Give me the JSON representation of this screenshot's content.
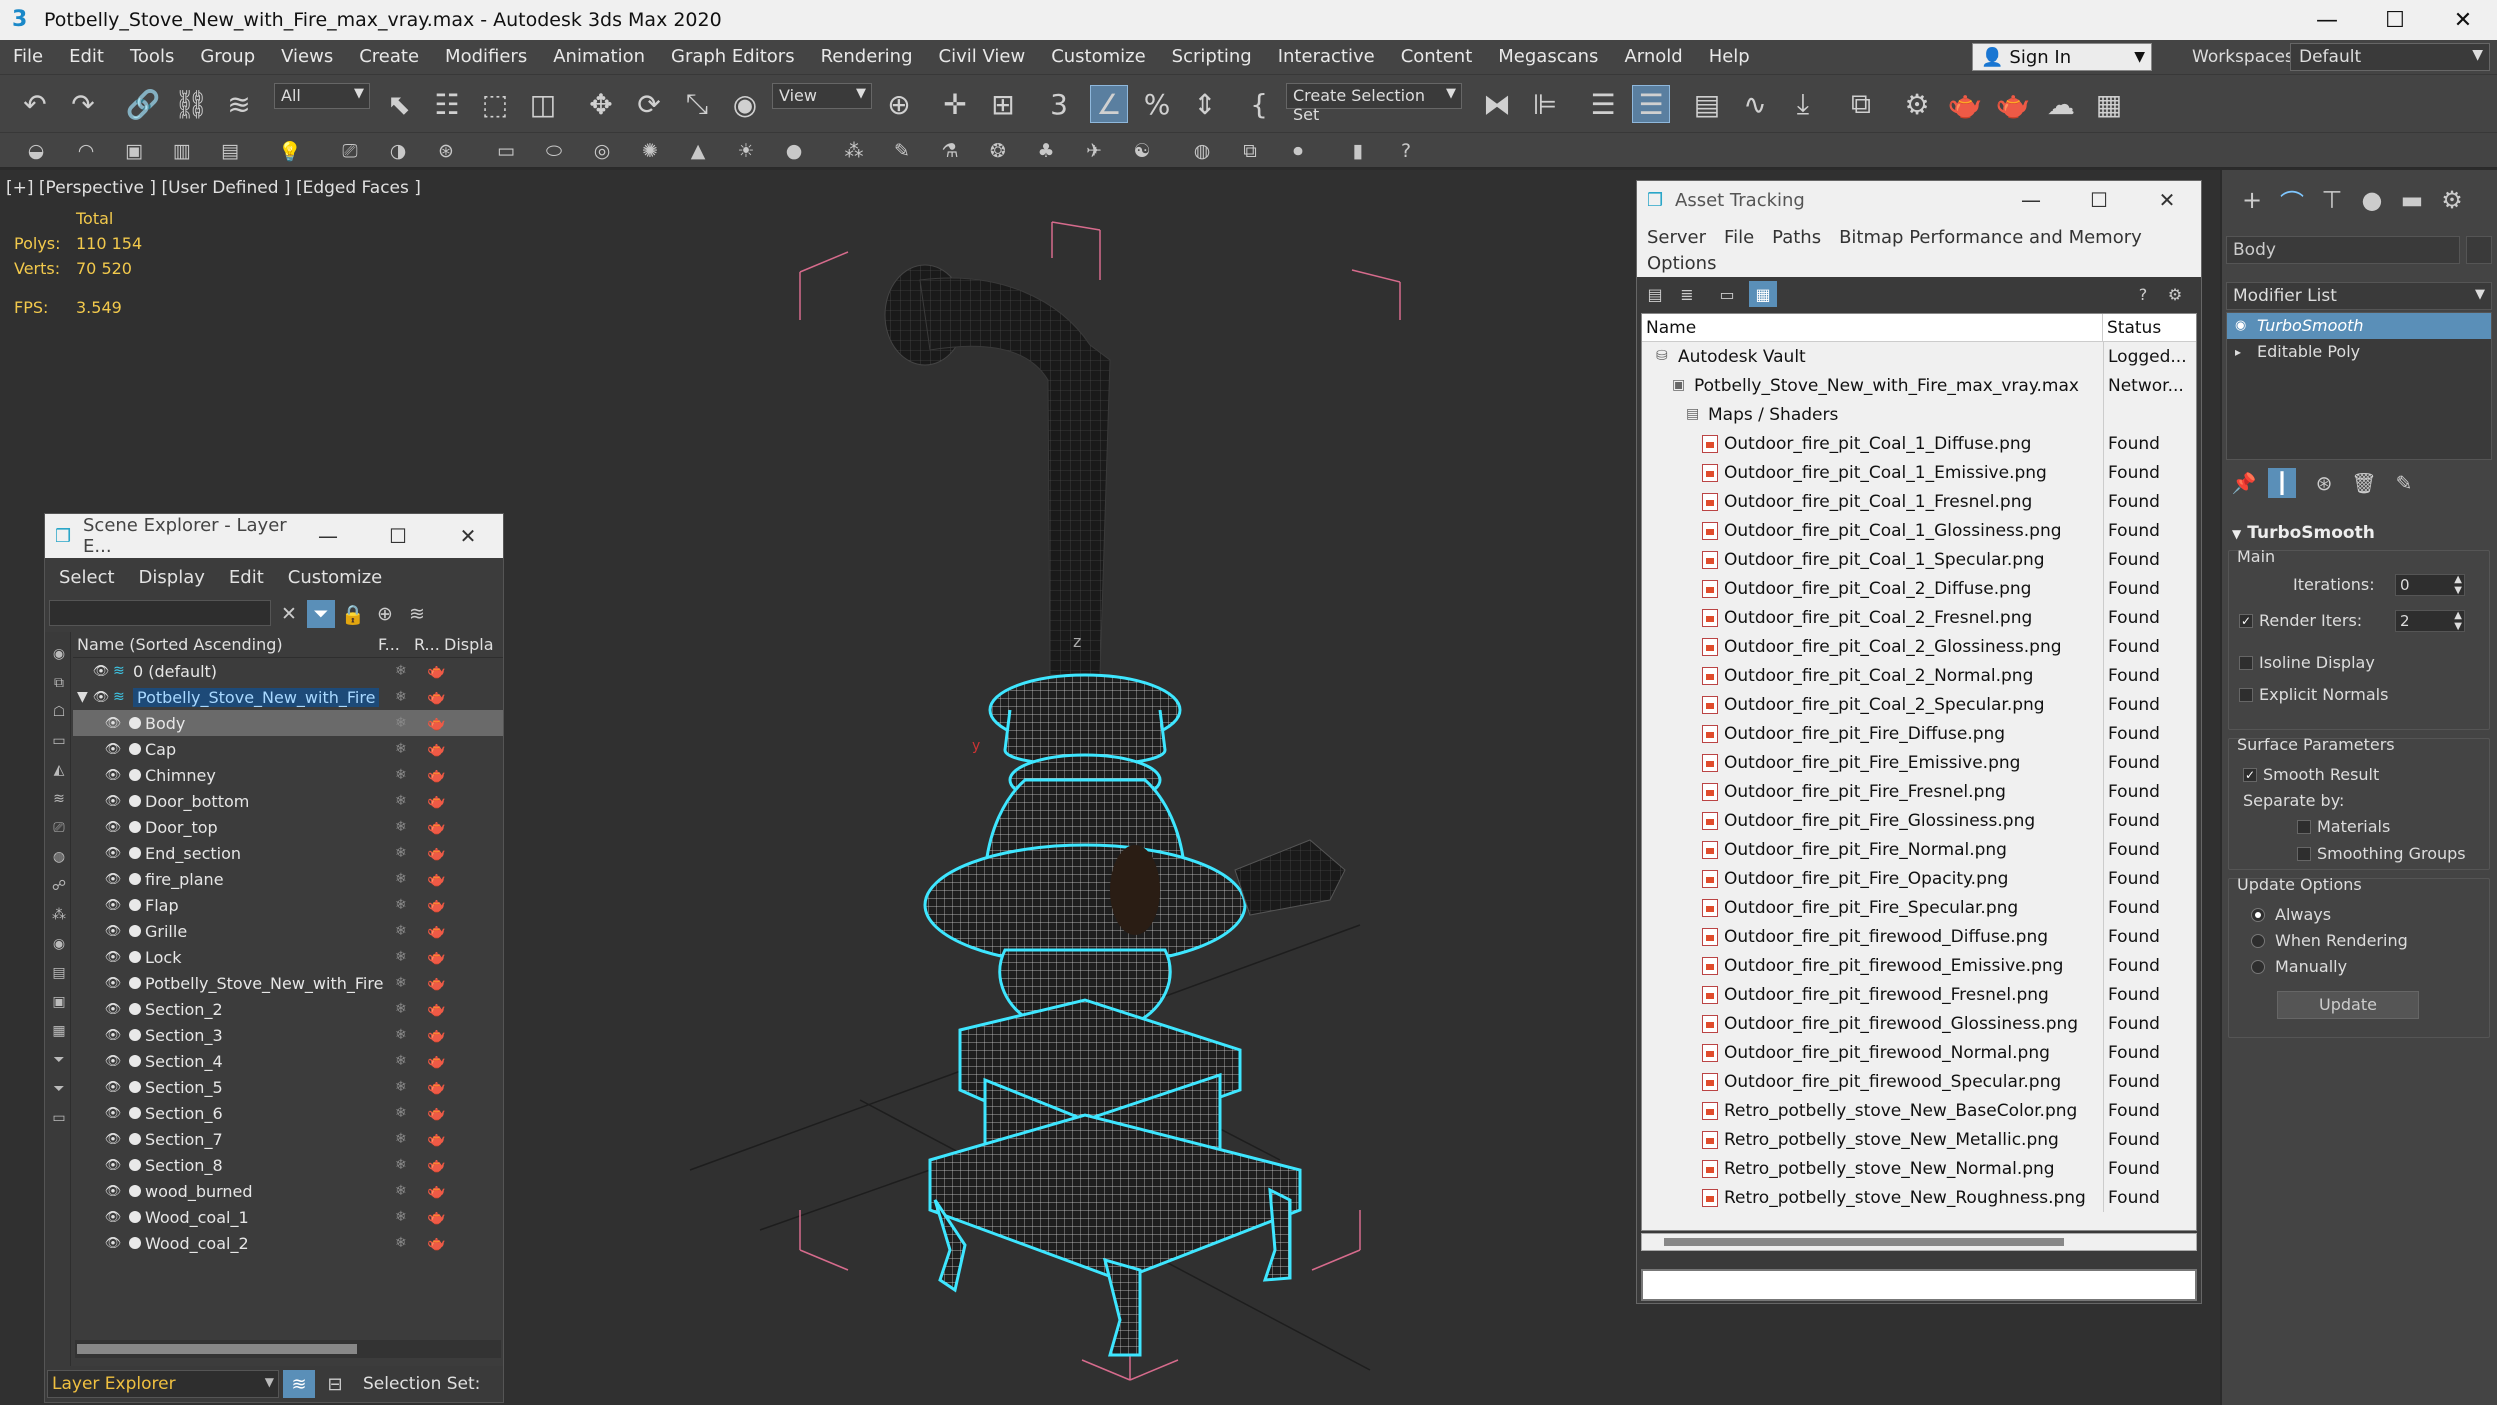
{
  "window": {
    "title": "Potbelly_Stove_New_with_Fire_max_vray.max - Autodesk 3ds Max 2020",
    "app_icon": "3",
    "minimize": "—",
    "maximize": "☐",
    "close": "✕"
  },
  "menu": [
    "File",
    "Edit",
    "Tools",
    "Group",
    "Views",
    "Create",
    "Modifiers",
    "Animation",
    "Graph Editors",
    "Rendering",
    "Civil View",
    "Customize",
    "Scripting",
    "Interactive",
    "Content",
    "Megascans",
    "Arnold",
    "Help"
  ],
  "signin": {
    "label": "Sign In"
  },
  "workspaces": {
    "label": "Workspaces:",
    "value": "Default"
  },
  "toolbar": {
    "selection_filter": "All",
    "reference_coord": "View",
    "selection_set_placeholder": "Create Selection Set"
  },
  "viewport": {
    "label": "[+] [Perspective ] [User Defined ] [Edged Faces ]",
    "stats": {
      "total_label": "Total",
      "polys_label": "Polys:",
      "polys_value": "110 154",
      "verts_label": "Verts:",
      "verts_value": "70 520",
      "fps_label": "FPS:",
      "fps_value": "3.549"
    },
    "axis_z": "z",
    "axis_y": "y"
  },
  "scene_explorer": {
    "title": "Scene Explorer - Layer E...",
    "menu": [
      "Select",
      "Display",
      "Edit",
      "Customize"
    ],
    "columns": {
      "name": "Name (Sorted Ascending)",
      "f": "F...",
      "r": "R...",
      "display": "Displa"
    },
    "rows": [
      {
        "name": "0 (default)",
        "level": 0,
        "type": "layer"
      },
      {
        "name": "Potbelly_Stove_New_with_Fire",
        "level": 0,
        "type": "layer-open"
      },
      {
        "name": "Body",
        "level": 1,
        "type": "object"
      },
      {
        "name": "Cap",
        "level": 1,
        "type": "object"
      },
      {
        "name": "Chimney",
        "level": 1,
        "type": "object"
      },
      {
        "name": "Door_bottom",
        "level": 1,
        "type": "object"
      },
      {
        "name": "Door_top",
        "level": 1,
        "type": "object"
      },
      {
        "name": "End_section",
        "level": 1,
        "type": "object"
      },
      {
        "name": "fire_plane",
        "level": 1,
        "type": "object"
      },
      {
        "name": "Flap",
        "level": 1,
        "type": "object"
      },
      {
        "name": "Grille",
        "level": 1,
        "type": "object"
      },
      {
        "name": "Lock",
        "level": 1,
        "type": "object"
      },
      {
        "name": "Potbelly_Stove_New_with_Fire",
        "level": 1,
        "type": "group"
      },
      {
        "name": "Section_2",
        "level": 1,
        "type": "object"
      },
      {
        "name": "Section_3",
        "level": 1,
        "type": "object"
      },
      {
        "name": "Section_4",
        "level": 1,
        "type": "object"
      },
      {
        "name": "Section_5",
        "level": 1,
        "type": "object"
      },
      {
        "name": "Section_6",
        "level": 1,
        "type": "object"
      },
      {
        "name": "Section_7",
        "level": 1,
        "type": "object"
      },
      {
        "name": "Section_8",
        "level": 1,
        "type": "object"
      },
      {
        "name": "wood_burned",
        "level": 1,
        "type": "object"
      },
      {
        "name": "Wood_coal_1",
        "level": 1,
        "type": "object"
      },
      {
        "name": "Wood_coal_2",
        "level": 1,
        "type": "object"
      }
    ],
    "selected_row": "Body",
    "bottom": {
      "layer_explorer": "Layer Explorer",
      "selection_set": "Selection Set:"
    }
  },
  "asset_tracking": {
    "title": "Asset Tracking",
    "menu": [
      "Server",
      "File",
      "Paths",
      "Bitmap Performance and Memory",
      "Options"
    ],
    "columns": {
      "name": "Name",
      "status": "Status"
    },
    "rows": [
      {
        "name": "Autodesk Vault",
        "status": "Logged...",
        "indent": 0,
        "icon": "vault"
      },
      {
        "name": "Potbelly_Stove_New_with_Fire_max_vray.max",
        "status": "Networ...",
        "indent": 1,
        "icon": "max"
      },
      {
        "name": "Maps / Shaders",
        "status": "",
        "indent": 2,
        "icon": "maps"
      },
      {
        "name": "Outdoor_fire_pit_Coal_1_Diffuse.png",
        "status": "Found",
        "indent": 3,
        "icon": "file"
      },
      {
        "name": "Outdoor_fire_pit_Coal_1_Emissive.png",
        "status": "Found",
        "indent": 3,
        "icon": "file"
      },
      {
        "name": "Outdoor_fire_pit_Coal_1_Fresnel.png",
        "status": "Found",
        "indent": 3,
        "icon": "file"
      },
      {
        "name": "Outdoor_fire_pit_Coal_1_Glossiness.png",
        "status": "Found",
        "indent": 3,
        "icon": "file"
      },
      {
        "name": "Outdoor_fire_pit_Coal_1_Specular.png",
        "status": "Found",
        "indent": 3,
        "icon": "file"
      },
      {
        "name": "Outdoor_fire_pit_Coal_2_Diffuse.png",
        "status": "Found",
        "indent": 3,
        "icon": "file"
      },
      {
        "name": "Outdoor_fire_pit_Coal_2_Fresnel.png",
        "status": "Found",
        "indent": 3,
        "icon": "file"
      },
      {
        "name": "Outdoor_fire_pit_Coal_2_Glossiness.png",
        "status": "Found",
        "indent": 3,
        "icon": "file"
      },
      {
        "name": "Outdoor_fire_pit_Coal_2_Normal.png",
        "status": "Found",
        "indent": 3,
        "icon": "file"
      },
      {
        "name": "Outdoor_fire_pit_Coal_2_Specular.png",
        "status": "Found",
        "indent": 3,
        "icon": "file"
      },
      {
        "name": "Outdoor_fire_pit_Fire_Diffuse.png",
        "status": "Found",
        "indent": 3,
        "icon": "file"
      },
      {
        "name": "Outdoor_fire_pit_Fire_Emissive.png",
        "status": "Found",
        "indent": 3,
        "icon": "file"
      },
      {
        "name": "Outdoor_fire_pit_Fire_Fresnel.png",
        "status": "Found",
        "indent": 3,
        "icon": "file"
      },
      {
        "name": "Outdoor_fire_pit_Fire_Glossiness.png",
        "status": "Found",
        "indent": 3,
        "icon": "file"
      },
      {
        "name": "Outdoor_fire_pit_Fire_Normal.png",
        "status": "Found",
        "indent": 3,
        "icon": "file"
      },
      {
        "name": "Outdoor_fire_pit_Fire_Opacity.png",
        "status": "Found",
        "indent": 3,
        "icon": "file"
      },
      {
        "name": "Outdoor_fire_pit_Fire_Specular.png",
        "status": "Found",
        "indent": 3,
        "icon": "file"
      },
      {
        "name": "Outdoor_fire_pit_firewood_Diffuse.png",
        "status": "Found",
        "indent": 3,
        "icon": "file"
      },
      {
        "name": "Outdoor_fire_pit_firewood_Emissive.png",
        "status": "Found",
        "indent": 3,
        "icon": "file"
      },
      {
        "name": "Outdoor_fire_pit_firewood_Fresnel.png",
        "status": "Found",
        "indent": 3,
        "icon": "file"
      },
      {
        "name": "Outdoor_fire_pit_firewood_Glossiness.png",
        "status": "Found",
        "indent": 3,
        "icon": "file"
      },
      {
        "name": "Outdoor_fire_pit_firewood_Normal.png",
        "status": "Found",
        "indent": 3,
        "icon": "file"
      },
      {
        "name": "Outdoor_fire_pit_firewood_Specular.png",
        "status": "Found",
        "indent": 3,
        "icon": "file"
      },
      {
        "name": "Retro_potbelly_stove_New_BaseColor.png",
        "status": "Found",
        "indent": 3,
        "icon": "file"
      },
      {
        "name": "Retro_potbelly_stove_New_Metallic.png",
        "status": "Found",
        "indent": 3,
        "icon": "file"
      },
      {
        "name": "Retro_potbelly_stove_New_Normal.png",
        "status": "Found",
        "indent": 3,
        "icon": "file"
      },
      {
        "name": "Retro_potbelly_stove_New_Roughness.png",
        "status": "Found",
        "indent": 3,
        "icon": "file"
      }
    ]
  },
  "command_panel": {
    "object_name": "Body",
    "modifier_list": "Modifier List",
    "stack": [
      {
        "name": "TurboSmooth",
        "selected": true
      },
      {
        "name": "Editable Poly",
        "selected": false
      }
    ],
    "turbosmooth": {
      "title": "TurboSmooth",
      "main_label": "Main",
      "iterations_label": "Iterations:",
      "iterations_value": "0",
      "render_iters_label": "Render Iters:",
      "render_iters_value": "2",
      "render_iters_checked": true,
      "isoline_label": "Isoline Display",
      "isoline_checked": false,
      "explicit_normals_label": "Explicit Normals",
      "explicit_normals_checked": false,
      "surface_params_label": "Surface Parameters",
      "smooth_result_label": "Smooth Result",
      "smooth_result_checked": true,
      "separate_by_label": "Separate by:",
      "materials_label": "Materials",
      "smoothing_groups_label": "Smoothing Groups",
      "update_options_label": "Update Options",
      "always_label": "Always",
      "when_rendering_label": "When Rendering",
      "manually_label": "Manually",
      "update_mode": "Always",
      "update_button": "Update"
    }
  },
  "colors": {
    "selection_cyan": "#3ee6ff",
    "bbox_pink": "#d66b8c",
    "stats_yellow": "#f2c94c",
    "accent_blue": "#5a8fb8"
  }
}
